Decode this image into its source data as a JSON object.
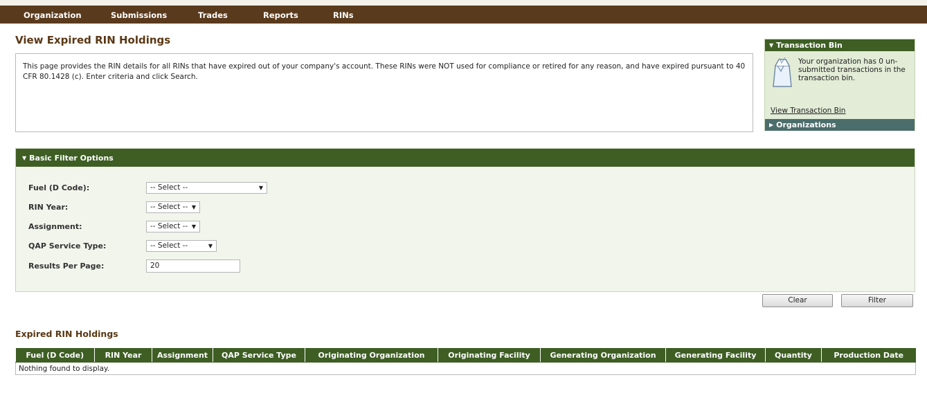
{
  "nav": {
    "items": [
      "Organization",
      "Submissions",
      "Trades",
      "Reports",
      "RINs"
    ]
  },
  "page": {
    "title": "View Expired RIN Holdings",
    "description": "This page provides the RIN details for all RINs that have expired out of your company's account. These RINs were NOT used for compliance or retired for any reason, and have expired pursuant to 40 CFR 80.1428 (c). Enter criteria and click Search."
  },
  "sidebar": {
    "transaction_bin": {
      "title": "Transaction Bin",
      "message": "Your organization has 0 un-submitted transactions in the transaction bin.",
      "link": "View Transaction Bin"
    },
    "organizations": {
      "title": "Organizations"
    }
  },
  "filter": {
    "title": "Basic Filter Options",
    "fields": [
      {
        "label": "Fuel (D Code):",
        "value": "-- Select --"
      },
      {
        "label": "RIN Year:",
        "value": "-- Select --"
      },
      {
        "label": "Assignment:",
        "value": "-- Select --"
      },
      {
        "label": "QAP Service Type:",
        "value": "-- Select --"
      },
      {
        "label": "Results Per Page:",
        "value": "20"
      }
    ],
    "clear_label": "Clear",
    "filter_label": "Filter"
  },
  "results": {
    "title": "Expired RIN Holdings",
    "columns": [
      "Fuel (D Code)",
      "RIN Year",
      "Assignment",
      "QAP Service Type",
      "Originating Organization",
      "Originating Facility",
      "Generating Organization",
      "Generating Facility",
      "Quantity",
      "Production Date"
    ],
    "empty_message": "Nothing found to display."
  },
  "colors": {
    "nav_bg": "#5a3a1c",
    "panel_header": "#3e5e24",
    "orgs_header": "#4b6d6b",
    "title_text": "#5a3814"
  },
  "icons": {
    "bin": "shopping-bag-icon",
    "expanded": "triangle-down-icon",
    "collapsed": "triangle-right-icon",
    "dropdown": "caret-down-icon"
  }
}
